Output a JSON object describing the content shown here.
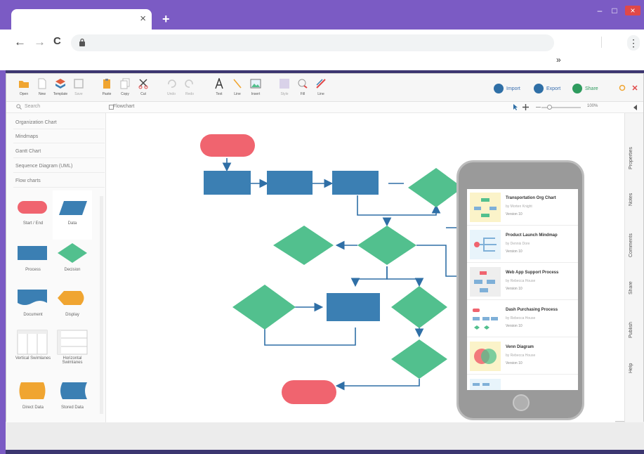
{
  "browser": {
    "tab_close": "×",
    "new_tab": "+",
    "back": "←",
    "forward": "→",
    "reload": "C",
    "menu": "⋮",
    "overflow": "»",
    "window": {
      "minimize": "–",
      "maximize": "□",
      "close": "×"
    }
  },
  "app": {
    "ribbon": [
      {
        "label": "Open",
        "icon": "folder-icon"
      },
      {
        "label": "New",
        "icon": "new-file-icon"
      },
      {
        "label": "Template",
        "icon": "template-icon"
      },
      {
        "label": "Save",
        "icon": "save-icon"
      },
      {
        "label": "Paste",
        "icon": "paste-icon"
      },
      {
        "label": "Copy",
        "icon": "copy-icon"
      },
      {
        "label": "Cut",
        "icon": "cut-icon"
      },
      {
        "label": "Undo",
        "icon": "undo-icon"
      },
      {
        "label": "Redo",
        "icon": "redo-icon"
      },
      {
        "label": "Text",
        "icon": "text-icon"
      },
      {
        "label": "Line",
        "icon": "line-icon"
      },
      {
        "label": "Insert",
        "icon": "image-icon"
      },
      {
        "label": "Style",
        "icon": "style-icon"
      },
      {
        "label": "Fill",
        "icon": "fill-icon"
      },
      {
        "label": "Line",
        "icon": "line-color-icon"
      }
    ],
    "actions": {
      "import": "Import",
      "export": "Export",
      "share": "Share"
    },
    "search_placeholder": "Search",
    "doc_tab": "Flowchart",
    "zoom": "100%",
    "libraries": [
      "Organization Chart",
      "Mindmaps",
      "Gantt Chart",
      "Sequence Diagram (UML)",
      "Flow charts"
    ],
    "shapes": [
      {
        "label": "Start / End"
      },
      {
        "label": "Data"
      },
      {
        "label": "Process"
      },
      {
        "label": "Decision"
      },
      {
        "label": "Document"
      },
      {
        "label": "Display"
      },
      {
        "label": "Vertical Swimlanes"
      },
      {
        "label": "Horizontal Swimlanes"
      },
      {
        "label": "Direct Data"
      },
      {
        "label": "Stored Data"
      }
    ],
    "right_panel": [
      "Properties",
      "Notes",
      "Comments",
      "Share",
      "Publish",
      "Help"
    ],
    "colors": {
      "terminal": "#f0646f",
      "process": "#3b7fb3",
      "decision": "#52c08e",
      "connector": "#2f6fa6"
    }
  },
  "phone": {
    "cards": [
      {
        "title": "Transportation Org Chart",
        "author": "by Morten Knight",
        "version": "Version 10"
      },
      {
        "title": "Product Launch Mindmap",
        "author": "by Dennis Dore",
        "version": "Version 10"
      },
      {
        "title": "Web App Support Process",
        "author": "by Rebecca House",
        "version": "Version 10"
      },
      {
        "title": "Dash Purchasing Process",
        "author": "by Rebecca House",
        "version": "Version 10"
      },
      {
        "title": "Venn Diagram",
        "author": "by Rebecca House",
        "version": "Version 10"
      }
    ]
  }
}
